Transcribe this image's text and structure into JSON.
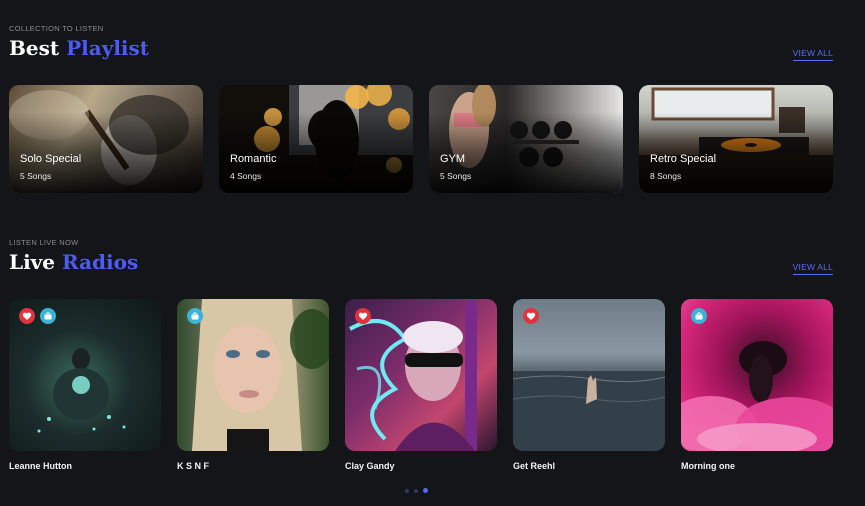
{
  "playlists_section": {
    "eyebrow": "COLLECTION TO LISTEN",
    "title_plain": "Best",
    "title_accent": "Playlist",
    "view_all": "VIEW ALL",
    "items": [
      {
        "name": "Solo Special",
        "count": "5 Songs"
      },
      {
        "name": "Romantic",
        "count": "4 Songs"
      },
      {
        "name": "GYM",
        "count": "5 Songs"
      },
      {
        "name": "Retro Special",
        "count": "8 Songs"
      }
    ]
  },
  "radios_section": {
    "eyebrow": "LISTEN LIVE NOW",
    "title_plain": "Live",
    "title_accent": "Radios",
    "view_all": "VIEW ALL",
    "items": [
      {
        "name": "Leanne Hutton",
        "badges": [
          "heart-icon",
          "broadcast-icon"
        ]
      },
      {
        "name": "K S N F",
        "badges": [
          "broadcast-icon"
        ]
      },
      {
        "name": "Clay Gandy",
        "badges": [
          "heart-icon"
        ]
      },
      {
        "name": "Get Reehl",
        "badges": [
          "heart-icon"
        ]
      },
      {
        "name": "Morning one",
        "badges": [
          "broadcast-icon"
        ]
      }
    ]
  },
  "carousel": {
    "pages": 3,
    "active_page": 3
  },
  "colors": {
    "background": "#141518",
    "accent": "#4d5cf5",
    "heart_badge": "#e0333c",
    "live_badge": "#3ab3d6"
  }
}
